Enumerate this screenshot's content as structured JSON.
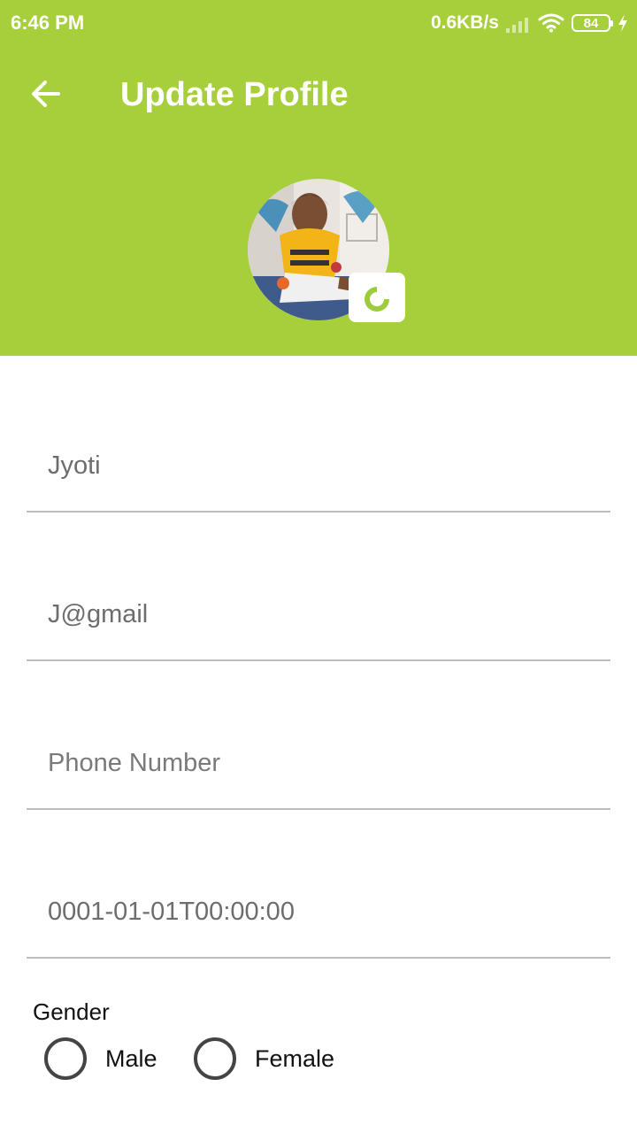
{
  "status_bar": {
    "time": "6:46 PM",
    "network_speed": "0.6KB/s",
    "battery_level": "84",
    "icons": [
      "signal-icon",
      "wifi-icon",
      "battery-icon",
      "charging-icon"
    ]
  },
  "toolbar": {
    "title": "Update Profile",
    "back_icon": "arrow-left-icon"
  },
  "profile": {
    "avatar": "profile-photo",
    "camera_icon": "camera-icon"
  },
  "form": {
    "name": {
      "value": "Jyoti",
      "placeholder": ""
    },
    "email": {
      "value": "J@gmail",
      "placeholder": ""
    },
    "phone": {
      "value": "",
      "placeholder": "Phone Number"
    },
    "dob": {
      "value": "0001-01-01T00:00:00",
      "placeholder": ""
    },
    "gender": {
      "label": "Gender",
      "options": [
        "Male",
        "Female"
      ],
      "selected": null
    }
  },
  "colors": {
    "header_background": "#a6cf3b",
    "field_underline": "#bdbdbd",
    "text_secondary": "#6d6d6d"
  }
}
